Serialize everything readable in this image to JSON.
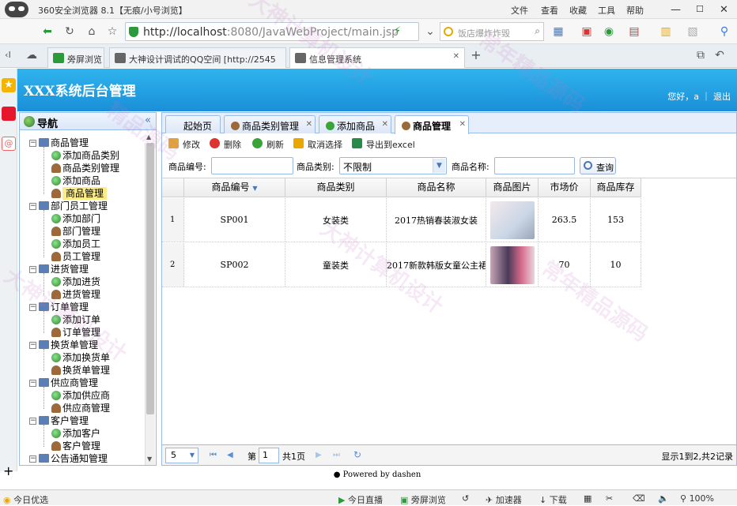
{
  "browser": {
    "title": "360安全浏览器 8.1【无痕/小号浏览】",
    "menu": [
      "文件",
      "查看",
      "收藏",
      "工具",
      "帮助"
    ],
    "url_host": "http://localhost",
    "url_rest": ":8080/JavaWebProject/main.jsp",
    "search_placeholder": "饭店爆炸炸毁",
    "tabs": [
      {
        "label": "旁屏浏览"
      },
      {
        "label": "大神设计调试的QQ空间 [http://2545"
      },
      {
        "label": "信息管理系统"
      }
    ]
  },
  "app": {
    "title": "XXX系统后台管理",
    "user_text": "您好，a ｜ 退出"
  },
  "nav": {
    "title": "导航",
    "collapse": "«",
    "groups": [
      {
        "label": "商品管理",
        "items": [
          "添加商品类别",
          "商品类别管理",
          "添加商品",
          "商品管理"
        ]
      },
      {
        "label": "部门员工管理",
        "items": [
          "添加部门",
          "部门管理",
          "添加员工",
          "员工管理"
        ]
      },
      {
        "label": "进货管理",
        "items": [
          "添加进货",
          "进货管理"
        ]
      },
      {
        "label": "订单管理",
        "items": [
          "添加订单",
          "订单管理"
        ]
      },
      {
        "label": "换货单管理",
        "items": [
          "添加换货单",
          "换货单管理"
        ]
      },
      {
        "label": "供应商管理",
        "items": [
          "添加供应商",
          "供应商管理"
        ]
      },
      {
        "label": "客户管理",
        "items": [
          "添加客户",
          "客户管理"
        ]
      },
      {
        "label": "公告通知管理",
        "items": []
      }
    ]
  },
  "panel_tabs": [
    "起始页",
    "商品类别管理",
    "添加商品",
    "商品管理"
  ],
  "toolbar": {
    "edit": "修改",
    "delete": "删除",
    "refresh": "刷新",
    "cancel_select": "取消选择",
    "export": "导出到excel"
  },
  "search": {
    "code_label": "商品编号:",
    "code_value": "",
    "type_label": "商品类别:",
    "type_value": "不限制",
    "name_label": "商品名称:",
    "name_value": "",
    "query": "查询"
  },
  "grid": {
    "columns": [
      "商品编号",
      "商品类别",
      "商品名称",
      "商品图片",
      "市场价",
      "商品库存"
    ],
    "rows": [
      {
        "num": "1",
        "code": "SP001",
        "type": "女装类",
        "name": "2017热销春装淑女装",
        "price": "263.5",
        "stock": "153"
      },
      {
        "num": "2",
        "code": "SP002",
        "type": "童装类",
        "name": "2017新款韩版女童公主裙",
        "price": "70",
        "stock": "10"
      }
    ]
  },
  "pager": {
    "page_size": "5",
    "page_prefix": "第",
    "page_value": "1",
    "page_total": "共1页",
    "summary": "显示1到2,共2记录"
  },
  "powered": "Powered by dashen",
  "statusbar": {
    "left": "今日优选",
    "items": [
      "今日直播",
      "旁屏浏览",
      "加速器",
      "下载"
    ],
    "zoom": "100%"
  },
  "colors": {
    "header": "#1a9be0",
    "panel_border": "#99bbe8"
  }
}
